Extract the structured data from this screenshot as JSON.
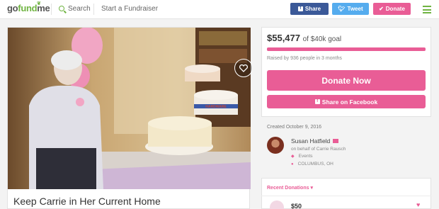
{
  "nav": {
    "logo_go": "go",
    "logo_fund": "fund",
    "logo_me": "me",
    "search_label": "Search",
    "start_label": "Start a Fundraiser",
    "share_label": "Share",
    "tweet_label": "Tweet",
    "donate_label": "Donate"
  },
  "campaign": {
    "title": "Keep Carrie in Her Current Home",
    "cake_text": "HARDWARE"
  },
  "donation": {
    "amount": "$55,477",
    "goal_text": "of $40k goal",
    "progress": 1.0,
    "raised_text": "Raised by 936 people in 3 months",
    "donate_now_label": "Donate Now",
    "fb_share_label": "Share on Facebook"
  },
  "organizer": {
    "created": "Created October 9, 2016",
    "name": "Susan Hatfield",
    "behalf": "on behalf of Carrie Rausch",
    "category": "Events",
    "location": "COLUMBUS, OH"
  },
  "recent": {
    "title": "Recent Donations",
    "first_amount": "$50"
  },
  "colors": {
    "accent": "#e95d96",
    "brand_green": "#70b442",
    "facebook": "#3b5998",
    "twitter": "#55acee"
  }
}
